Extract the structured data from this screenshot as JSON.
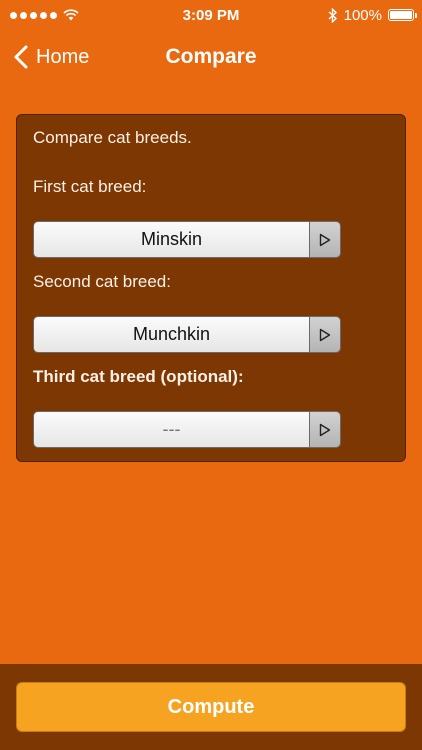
{
  "status_bar": {
    "time": "3:09 PM",
    "battery": "100%",
    "icons": [
      "signal-dots-icon",
      "wifi-icon",
      "bluetooth-icon",
      "battery-icon"
    ]
  },
  "nav": {
    "back_label": "Home",
    "title": "Compare"
  },
  "panel": {
    "intro": "Compare cat breeds.",
    "first_label": "First cat breed:",
    "first_value": "Minskin",
    "second_label": "Second cat breed:",
    "second_value": "Munchkin",
    "third_label": "Third cat breed (optional):",
    "third_value": "---"
  },
  "bottom": {
    "compute_label": "Compute"
  },
  "colors": {
    "background": "#e8690f",
    "panel": "#7c3703",
    "button": "#f5a321"
  }
}
